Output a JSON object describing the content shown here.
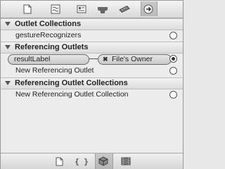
{
  "toolbar": {
    "icons": [
      "file-inspector-icon",
      "quick-help-icon",
      "identity-inspector-icon",
      "attributes-inspector-icon",
      "size-inspector-icon",
      "connections-inspector-icon"
    ],
    "selected": "connections-inspector-icon"
  },
  "sections": {
    "outlet_collections": {
      "title": "Outlet Collections",
      "items": [
        {
          "label": "gestureRecognizers"
        }
      ]
    },
    "referencing_outlets": {
      "title": "Referencing Outlets",
      "connection": {
        "source": "resultLabel",
        "target": "File's Owner"
      },
      "items": [
        {
          "label": "New Referencing Outlet"
        }
      ]
    },
    "referencing_outlet_collections": {
      "title": "Referencing Outlet Collections",
      "items": [
        {
          "label": "New Referencing Outlet Collection"
        }
      ]
    }
  },
  "bottombar": {
    "code_label": "{ }",
    "icons": [
      "file-template-icon",
      "code-snippet-icon",
      "object-library-icon",
      "media-library-icon"
    ],
    "selected": "object-library-icon"
  }
}
